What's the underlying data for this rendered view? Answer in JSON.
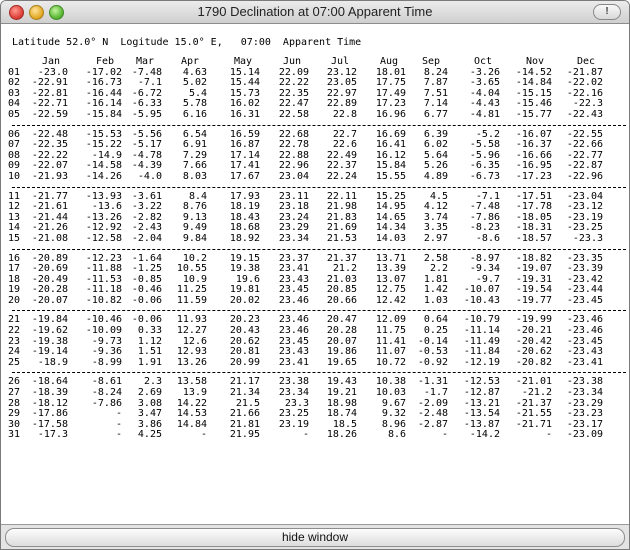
{
  "window": {
    "title": "1790 Declination at 07:00  Apparent Time",
    "alert_icon": "!"
  },
  "header_line": "Latitude 52.0° N  Logitude 15.0° E,   07:00  Apparent Time",
  "months": [
    "Jan",
    "Feb",
    "Mar",
    "Apr",
    "May",
    "Jun",
    "Jul",
    "Aug",
    "Sep",
    "Oct",
    "Nov",
    "Dec"
  ],
  "groups": [
    [
      [
        "01",
        "-23.0",
        "-17.02",
        "-7.48",
        "4.63",
        "15.14",
        "22.09",
        "23.12",
        "18.01",
        "8.24",
        "-3.26",
        "-14.52",
        "-21.87"
      ],
      [
        "02",
        "-22.91",
        "-16.73",
        "-7.1",
        "5.02",
        "15.44",
        "22.22",
        "23.05",
        "17.75",
        "7.87",
        "-3.65",
        "-14.84",
        "-22.02"
      ],
      [
        "03",
        "-22.81",
        "-16.44",
        "-6.72",
        "5.4",
        "15.73",
        "22.35",
        "22.97",
        "17.49",
        "7.51",
        "-4.04",
        "-15.15",
        "-22.16"
      ],
      [
        "04",
        "-22.71",
        "-16.14",
        "-6.33",
        "5.78",
        "16.02",
        "22.47",
        "22.89",
        "17.23",
        "7.14",
        "-4.43",
        "-15.46",
        "-22.3"
      ],
      [
        "05",
        "-22.59",
        "-15.84",
        "-5.95",
        "6.16",
        "16.31",
        "22.58",
        "22.8",
        "16.96",
        "6.77",
        "-4.81",
        "-15.77",
        "-22.43"
      ]
    ],
    [
      [
        "06",
        "-22.48",
        "-15.53",
        "-5.56",
        "6.54",
        "16.59",
        "22.68",
        "22.7",
        "16.69",
        "6.39",
        "-5.2",
        "-16.07",
        "-22.55"
      ],
      [
        "07",
        "-22.35",
        "-15.22",
        "-5.17",
        "6.91",
        "16.87",
        "22.78",
        "22.6",
        "16.41",
        "6.02",
        "-5.58",
        "-16.37",
        "-22.66"
      ],
      [
        "08",
        "-22.22",
        "-14.9",
        "-4.78",
        "7.29",
        "17.14",
        "22.88",
        "22.49",
        "16.12",
        "5.64",
        "-5.96",
        "-16.66",
        "-22.77"
      ],
      [
        "09",
        "-22.07",
        "-14.58",
        "-4.39",
        "7.66",
        "17.41",
        "22.96",
        "22.37",
        "15.84",
        "5.26",
        "-6.35",
        "-16.95",
        "-22.87"
      ],
      [
        "10",
        "-21.93",
        "-14.26",
        "-4.0",
        "8.03",
        "17.67",
        "23.04",
        "22.24",
        "15.55",
        "4.89",
        "-6.73",
        "-17.23",
        "-22.96"
      ]
    ],
    [
      [
        "11",
        "-21.77",
        "-13.93",
        "-3.61",
        "8.4",
        "17.93",
        "23.11",
        "22.11",
        "15.25",
        "4.5",
        "-7.1",
        "-17.51",
        "-23.04"
      ],
      [
        "12",
        "-21.61",
        "-13.6",
        "-3.22",
        "8.76",
        "18.19",
        "23.18",
        "21.98",
        "14.95",
        "4.12",
        "-7.48",
        "-17.78",
        "-23.12"
      ],
      [
        "13",
        "-21.44",
        "-13.26",
        "-2.82",
        "9.13",
        "18.43",
        "23.24",
        "21.83",
        "14.65",
        "3.74",
        "-7.86",
        "-18.05",
        "-23.19"
      ],
      [
        "14",
        "-21.26",
        "-12.92",
        "-2.43",
        "9.49",
        "18.68",
        "23.29",
        "21.69",
        "14.34",
        "3.35",
        "-8.23",
        "-18.31",
        "-23.25"
      ],
      [
        "15",
        "-21.08",
        "-12.58",
        "-2.04",
        "9.84",
        "18.92",
        "23.34",
        "21.53",
        "14.03",
        "2.97",
        "-8.6",
        "-18.57",
        "-23.3"
      ]
    ],
    [
      [
        "16",
        "-20.89",
        "-12.23",
        "-1.64",
        "10.2",
        "19.15",
        "23.37",
        "21.37",
        "13.71",
        "2.58",
        "-8.97",
        "-18.82",
        "-23.35"
      ],
      [
        "17",
        "-20.69",
        "-11.88",
        "-1.25",
        "10.55",
        "19.38",
        "23.41",
        "21.2",
        "13.39",
        "2.2",
        "-9.34",
        "-19.07",
        "-23.39"
      ],
      [
        "18",
        "-20.49",
        "-11.53",
        "-0.85",
        "10.9",
        "19.6",
        "23.43",
        "21.03",
        "13.07",
        "1.81",
        "-9.7",
        "-19.31",
        "-23.42"
      ],
      [
        "19",
        "-20.28",
        "-11.18",
        "-0.46",
        "11.25",
        "19.81",
        "23.45",
        "20.85",
        "12.75",
        "1.42",
        "-10.07",
        "-19.54",
        "-23.44"
      ],
      [
        "20",
        "-20.07",
        "-10.82",
        "-0.06",
        "11.59",
        "20.02",
        "23.46",
        "20.66",
        "12.42",
        "1.03",
        "-10.43",
        "-19.77",
        "-23.45"
      ]
    ],
    [
      [
        "21",
        "-19.84",
        "-10.46",
        "-0.06",
        "11.93",
        "20.23",
        "23.46",
        "20.47",
        "12.09",
        "0.64",
        "-10.79",
        "-19.99",
        "-23.46"
      ],
      [
        "22",
        "-19.62",
        "-10.09",
        "0.33",
        "12.27",
        "20.43",
        "23.46",
        "20.28",
        "11.75",
        "0.25",
        "-11.14",
        "-20.21",
        "-23.46"
      ],
      [
        "23",
        "-19.38",
        "-9.73",
        "1.12",
        "12.6",
        "20.62",
        "23.45",
        "20.07",
        "11.41",
        "-0.14",
        "-11.49",
        "-20.42",
        "-23.45"
      ],
      [
        "24",
        "-19.14",
        "-9.36",
        "1.51",
        "12.93",
        "20.81",
        "23.43",
        "19.86",
        "11.07",
        "-0.53",
        "-11.84",
        "-20.62",
        "-23.43"
      ],
      [
        "25",
        "-18.9",
        "-8.99",
        "1.91",
        "13.26",
        "20.99",
        "23.41",
        "19.65",
        "10.72",
        "-0.92",
        "-12.19",
        "-20.82",
        "-23.41"
      ]
    ],
    [
      [
        "26",
        "-18.64",
        "-8.61",
        "2.3",
        "13.58",
        "21.17",
        "23.38",
        "19.43",
        "10.38",
        "-1.31",
        "-12.53",
        "-21.01",
        "-23.38"
      ],
      [
        "27",
        "-18.39",
        "-8.24",
        "2.69",
        "13.9",
        "21.34",
        "23.34",
        "19.21",
        "10.03",
        "-1.7",
        "-12.87",
        "-21.2",
        "-23.34"
      ],
      [
        "28",
        "-18.12",
        "-7.86",
        "3.08",
        "14.22",
        "21.5",
        "23.3",
        "18.98",
        "9.67",
        "-2.09",
        "-13.21",
        "-21.37",
        "-23.29"
      ],
      [
        "29",
        "-17.86",
        "-",
        "3.47",
        "14.53",
        "21.66",
        "23.25",
        "18.74",
        "9.32",
        "-2.48",
        "-13.54",
        "-21.55",
        "-23.23"
      ],
      [
        "30",
        "-17.58",
        "-",
        "3.86",
        "14.84",
        "21.81",
        "23.19",
        "18.5",
        "8.96",
        "-2.87",
        "-13.87",
        "-21.71",
        "-23.17"
      ],
      [
        "31",
        "-17.3",
        "-",
        "4.25",
        "-",
        "21.95",
        "-",
        "18.26",
        "8.6",
        "-",
        "-14.2",
        "-",
        "-23.09"
      ]
    ]
  ],
  "footer": {
    "hide_label": "hide window"
  },
  "colors": {
    "titlebar": "#d9d9d9",
    "close": "#e0443e",
    "minimize": "#e5ad2c",
    "zoom": "#5fbb3a"
  }
}
